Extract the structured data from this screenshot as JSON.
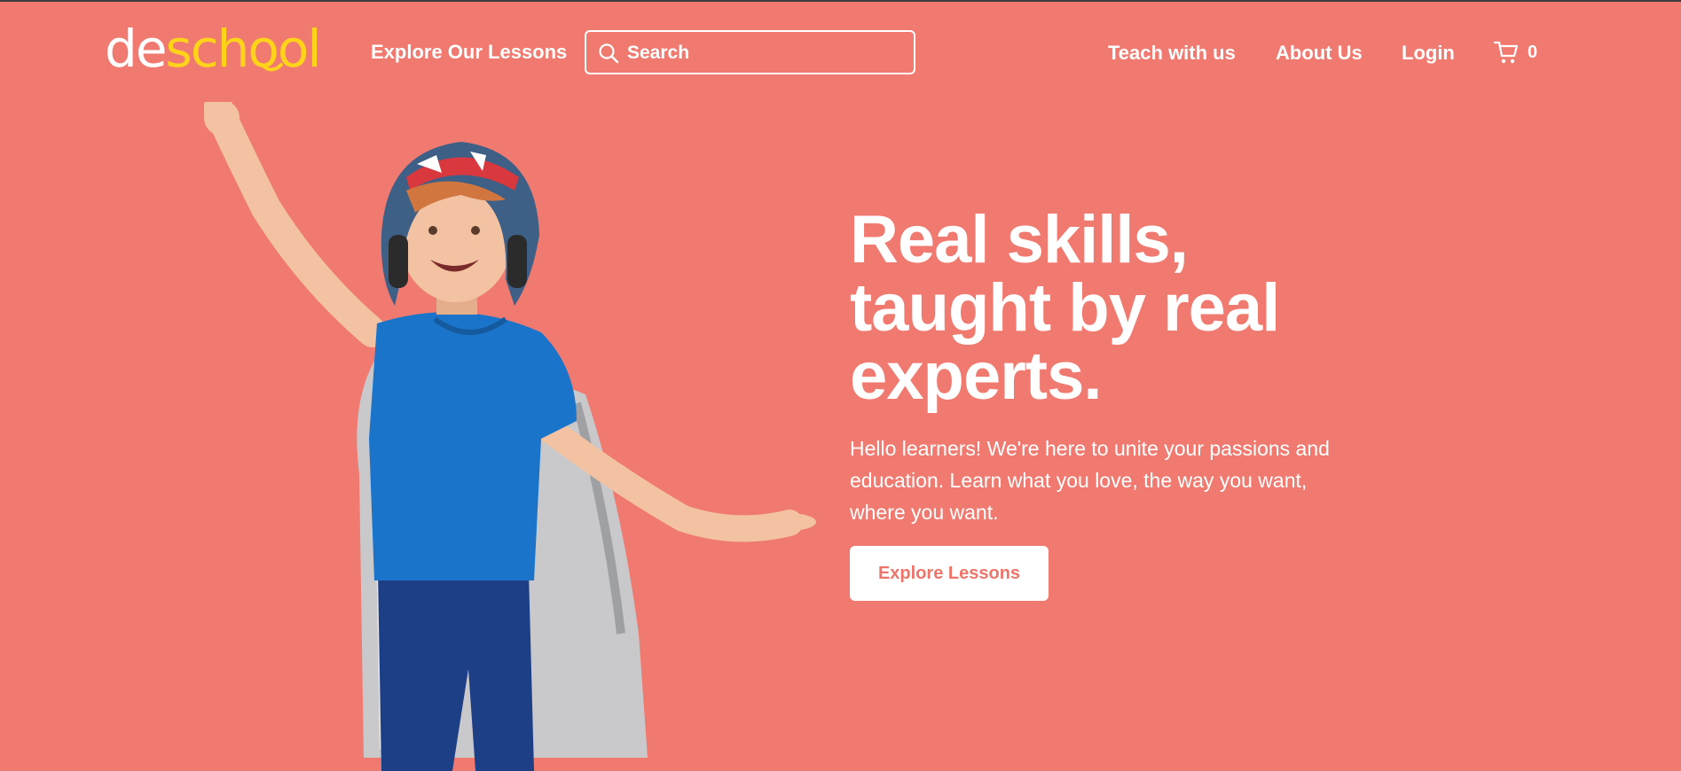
{
  "colors": {
    "background": "#f07a70",
    "accent_yellow": "#ffd31a",
    "cta_text": "#ef746a",
    "shirt_blue": "#1a74c9"
  },
  "brand": {
    "logo_prefix": "de",
    "logo_suffix": "school"
  },
  "nav": {
    "explore": "Explore Our Lessons",
    "search_placeholder": "Search",
    "teach": "Teach with us",
    "about": "About Us",
    "login": "Login",
    "cart_count": "0"
  },
  "hero": {
    "headline_lines": [
      "Real skills,",
      "taught by real",
      "experts."
    ],
    "sub_lines": [
      "Hello learners! We're here to unite your passions and",
      "education. Learn what you love, the way you want,",
      "where you want."
    ],
    "cta": "Explore Lessons"
  },
  "icons": {
    "search": "search-icon",
    "cart": "cart-icon",
    "logo_smile": "smile-icon"
  }
}
